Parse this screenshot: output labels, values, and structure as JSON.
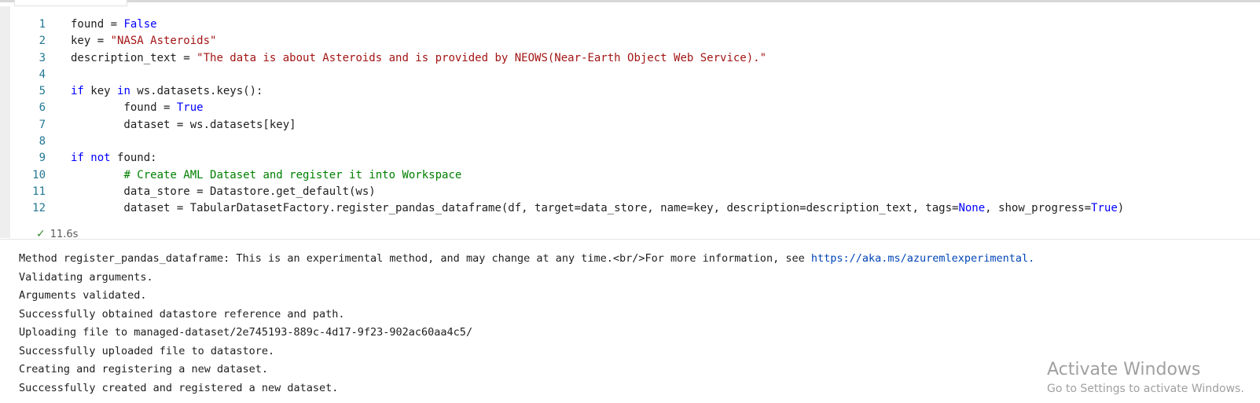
{
  "code": {
    "lines": [
      {
        "n": "1",
        "tokens": [
          {
            "t": "found = ",
            "c": ""
          },
          {
            "t": "False",
            "c": "kw"
          }
        ]
      },
      {
        "n": "2",
        "tokens": [
          {
            "t": "key = ",
            "c": ""
          },
          {
            "t": "\"NASA Asteroids\"",
            "c": "str"
          }
        ]
      },
      {
        "n": "3",
        "tokens": [
          {
            "t": "description_text = ",
            "c": ""
          },
          {
            "t": "\"The data is about Asteroids and is provided by NEOWS(Near-Earth Object Web Service).\"",
            "c": "str"
          }
        ]
      },
      {
        "n": "4",
        "tokens": []
      },
      {
        "n": "5",
        "tokens": [
          {
            "t": "if",
            "c": "kw"
          },
          {
            "t": " key ",
            "c": ""
          },
          {
            "t": "in",
            "c": "kw"
          },
          {
            "t": " ws.datasets.keys():",
            "c": ""
          }
        ]
      },
      {
        "n": "6",
        "tokens": [
          {
            "t": "        found = ",
            "c": ""
          },
          {
            "t": "True",
            "c": "kw"
          }
        ]
      },
      {
        "n": "7",
        "tokens": [
          {
            "t": "        dataset = ws.datasets[key]",
            "c": ""
          }
        ]
      },
      {
        "n": "8",
        "tokens": []
      },
      {
        "n": "9",
        "tokens": [
          {
            "t": "if",
            "c": "kw"
          },
          {
            "t": " ",
            "c": ""
          },
          {
            "t": "not",
            "c": "kw"
          },
          {
            "t": " found:",
            "c": ""
          }
        ]
      },
      {
        "n": "10",
        "tokens": [
          {
            "t": "        ",
            "c": ""
          },
          {
            "t": "# Create AML Dataset and register it into Workspace",
            "c": "cmt"
          }
        ]
      },
      {
        "n": "11",
        "tokens": [
          {
            "t": "        data_store = Datastore.get_default(ws)",
            "c": ""
          }
        ]
      },
      {
        "n": "12",
        "tokens": [
          {
            "t": "        dataset = TabularDatasetFactory.register_pandas_dataframe(df, target=data_store, name=key, description=description_text, tags=",
            "c": ""
          },
          {
            "t": "None",
            "c": "kw"
          },
          {
            "t": ", show_progress=",
            "c": ""
          },
          {
            "t": "True",
            "c": "kw"
          },
          {
            "t": ")",
            "c": ""
          }
        ]
      }
    ]
  },
  "status": {
    "check": "✓",
    "duration": "11.6s"
  },
  "output": {
    "line1_text": "Method register_pandas_dataframe: This is an experimental method, and may change at any time.<br/>For more information, see ",
    "line1_link": "https://aka.ms/azuremlexperimental.",
    "lines": [
      "Validating arguments.",
      "Arguments validated.",
      "Successfully obtained datastore reference and path.",
      "Uploading file to managed-dataset/2e745193-889c-4d17-9f23-902ac60aa4c5/",
      "Successfully uploaded file to datastore.",
      "Creating and registering a new dataset.",
      "Successfully created and registered a new dataset."
    ]
  },
  "watermark": {
    "title": "Activate Windows",
    "subtitle": "Go to Settings to activate Windows."
  },
  "colors": {
    "keyword": "#0000ff",
    "string": "#a31515",
    "comment": "#008000",
    "line_number": "#237893",
    "link": "#0045b5",
    "success": "#388a34"
  }
}
